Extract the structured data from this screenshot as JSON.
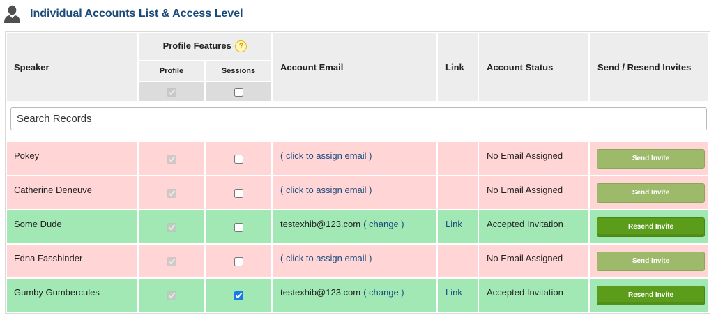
{
  "page": {
    "title": "Individual Accounts List & Access Level"
  },
  "icons": {
    "title_icon": "user-icon",
    "help_icon": "help-icon"
  },
  "colors": {
    "title": "#1b4a7a",
    "link": "#1c4d80",
    "header_bg": "#ededed",
    "header_checkbox_bg": "#dcdcdc",
    "row_pending": "#ffd5d6",
    "row_accepted": "#a1e8b5",
    "button_send": "#9dba6b",
    "button_resend": "#5b9c1b"
  },
  "table": {
    "headers": {
      "speaker": "Speaker",
      "profile_features": "Profile Features",
      "help_glyph": "?",
      "profile": "Profile",
      "sessions": "Sessions",
      "account_email": "Account Email",
      "link": "Link",
      "account_status": "Account Status",
      "send_resend_invites": "Send / Resend Invites"
    },
    "header_checkboxes": {
      "profile": {
        "checked": true,
        "disabled": true
      },
      "sessions": {
        "checked": false,
        "disabled": false
      }
    },
    "search": {
      "placeholder": "Search Records"
    },
    "rows": [
      {
        "speaker": "Pokey",
        "state": "pending",
        "profile": {
          "checked": true,
          "disabled": true
        },
        "sessions": {
          "checked": false,
          "disabled": false
        },
        "email_action": "( click to assign email )",
        "status": "No Email Assigned",
        "button": "Send Invite",
        "button_type": "send"
      },
      {
        "speaker": "Catherine Deneuve",
        "state": "pending",
        "profile": {
          "checked": true,
          "disabled": true
        },
        "sessions": {
          "checked": false,
          "disabled": false
        },
        "email_action": "( click to assign email )",
        "status": "No Email Assigned",
        "button": "Send Invite",
        "button_type": "send"
      },
      {
        "speaker": "Some Dude",
        "state": "accepted",
        "profile": {
          "checked": true,
          "disabled": true
        },
        "sessions": {
          "checked": false,
          "disabled": false
        },
        "email": "testexhib@123.com",
        "email_action": "( change )",
        "link": "Link",
        "status": "Accepted Invitation",
        "button": "Resend Invite",
        "button_type": "resend"
      },
      {
        "speaker": "Edna Fassbinder",
        "state": "pending",
        "profile": {
          "checked": true,
          "disabled": true
        },
        "sessions": {
          "checked": false,
          "disabled": false
        },
        "email_action": "( click to assign email )",
        "status": "No Email Assigned",
        "button": "Send Invite",
        "button_type": "send"
      },
      {
        "speaker": "Gumby Gumbercules",
        "state": "accepted",
        "profile": {
          "checked": true,
          "disabled": true
        },
        "sessions": {
          "checked": true,
          "disabled": false
        },
        "email": "testexhib@123.com",
        "email_action": "( change )",
        "link": "Link",
        "status": "Accepted Invitation",
        "button": "Resend Invite",
        "button_type": "resend"
      }
    ]
  }
}
